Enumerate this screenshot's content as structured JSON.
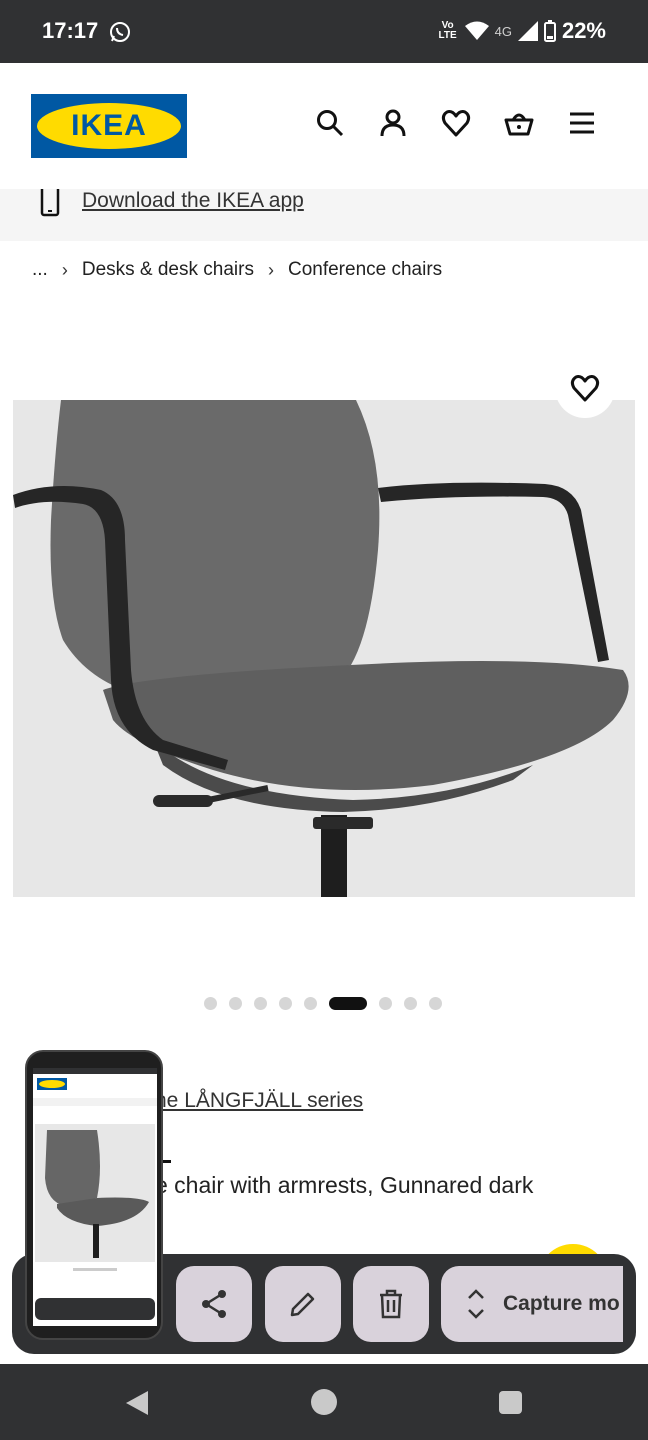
{
  "status_bar": {
    "time": "17:17",
    "volte": "Vo LTE",
    "network": "4G",
    "battery": "22%"
  },
  "header": {
    "logo_text": "IKEA",
    "icons": [
      "search-icon",
      "profile-icon",
      "favourites-icon",
      "basket-icon",
      "menu-icon"
    ]
  },
  "banner": {
    "link_text": "Download the IKEA app"
  },
  "breadcrumb": {
    "ellipsis": "...",
    "items": [
      "Desks & desk chairs",
      "Conference chairs"
    ]
  },
  "carousel": {
    "total_images": 9,
    "active_index": 5
  },
  "product": {
    "series_link": "he LÅNGFJÄLL series",
    "description": "e chair with armrests, Gunnared dark"
  },
  "screenshot_toolbar": {
    "capture_label": "Capture mo",
    "buttons": [
      "share-icon",
      "edit-icon",
      "delete-icon"
    ]
  },
  "colors": {
    "ikea_blue": "#0058a3",
    "ikea_yellow": "#ffdb00",
    "system_bar": "#303133",
    "toolbar_button": "#d9d2db"
  }
}
